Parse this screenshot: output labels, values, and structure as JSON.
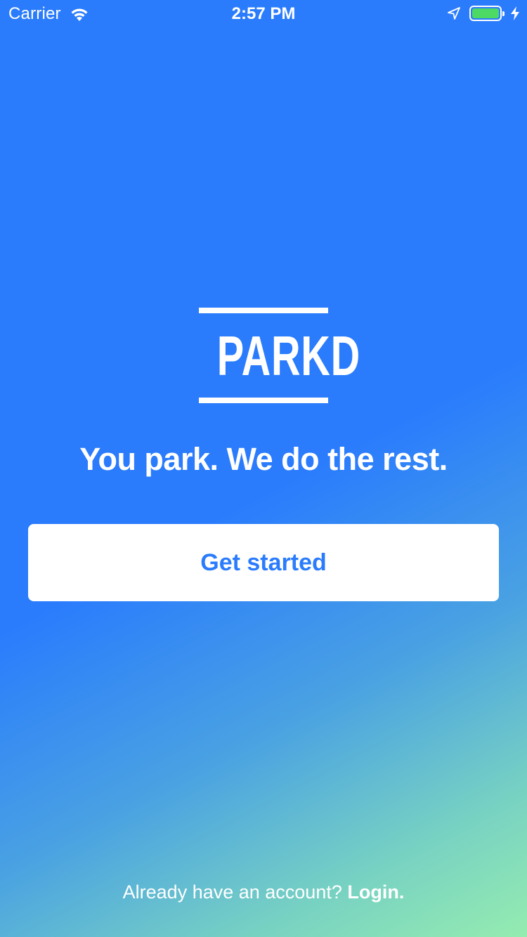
{
  "status_bar": {
    "carrier": "Carrier",
    "time": "2:57 PM",
    "battery_color": "#4cd964",
    "icons": [
      "wifi-icon",
      "location-arrow-icon",
      "battery-icon",
      "charging-bolt-icon"
    ]
  },
  "logo": {
    "text": "PARKD"
  },
  "tagline": "You park. We do the rest.",
  "cta": {
    "label": "Get started"
  },
  "login": {
    "prompt": "Already have an account? ",
    "link": "Login."
  },
  "colors": {
    "accent": "#2a7cfd",
    "gradient_end": "#95ecb0",
    "button_bg": "#ffffff"
  }
}
